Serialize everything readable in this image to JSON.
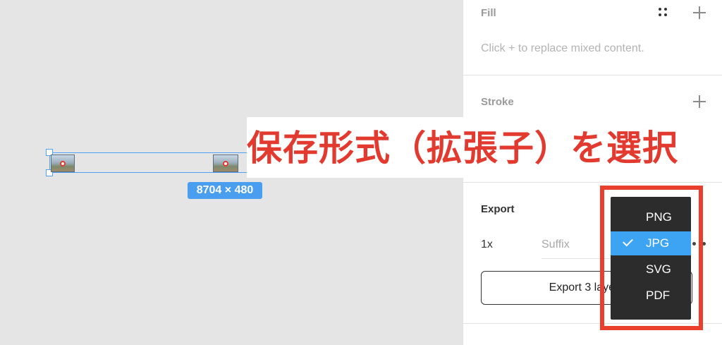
{
  "canvas": {
    "size_badge": "8704 × 480"
  },
  "panel": {
    "fill": {
      "label": "Fill",
      "hint": "Click + to replace mixed content."
    },
    "stroke": {
      "label": "Stroke"
    },
    "export": {
      "label": "Export",
      "scale": "1x",
      "suffix_placeholder": "Suffix",
      "button_label": "Export 3 layers"
    }
  },
  "overlay": {
    "annotation": "保存形式（拡張子）を選択",
    "color": "#e23a2f"
  },
  "format_menu": {
    "options": [
      "PNG",
      "JPG",
      "SVG",
      "PDF"
    ],
    "selected": "JPG",
    "highlight_color": "#3da4f4"
  },
  "icons": {
    "add": "plus-icon",
    "styles": "four-dots-icon",
    "check": "checkmark-icon",
    "more": "more-dots-icon"
  },
  "accent_color": "#4ea1f5"
}
